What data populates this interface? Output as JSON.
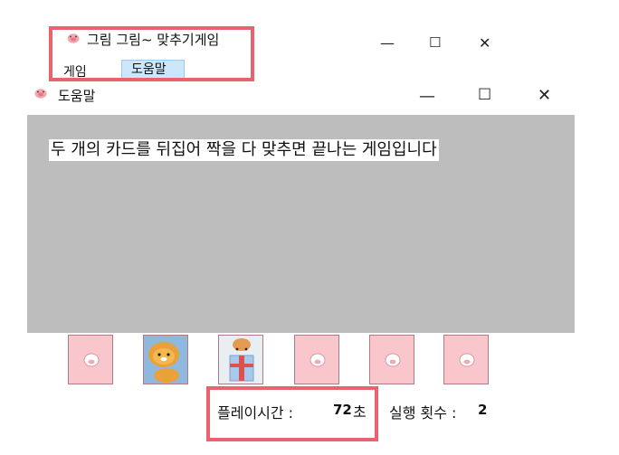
{
  "main_window": {
    "title": "그림 그림~ 맞추기게임",
    "icon": "pig-face-icon",
    "controls": {
      "minimize": "—",
      "maximize": "☐",
      "close": "✕"
    }
  },
  "menu": {
    "items": [
      {
        "label": "게임"
      },
      {
        "label": "도움말",
        "selected": true
      }
    ]
  },
  "help_dialog": {
    "title": "도움말",
    "icon": "pig-face-icon",
    "message": "두 개의 카드를 뒤집어 짝을 다 맞추면 끝나는 게임입니다",
    "controls": {
      "minimize": "—",
      "maximize": "☐",
      "close": "✕"
    }
  },
  "cards": [
    {
      "state": "face-down",
      "icon": "pig-face-icon"
    },
    {
      "state": "face-up",
      "icon": "lion-character-icon"
    },
    {
      "state": "face-up",
      "icon": "gift-box-character-icon"
    },
    {
      "state": "face-down",
      "icon": "pig-face-icon"
    },
    {
      "state": "face-down",
      "icon": "pig-face-icon"
    },
    {
      "state": "face-down",
      "icon": "pig-face-icon"
    }
  ],
  "status": {
    "playtime_label": "플레이시간 :",
    "playtime_value": "72",
    "playtime_unit": "초",
    "tries_label": "실행 횟수 :",
    "tries_value": "2"
  },
  "colors": {
    "highlight": "#e9636f",
    "dialog_background": "#bdbdbd",
    "card_back": "#f9c6cb",
    "menu_selected": "#cce6fb"
  }
}
